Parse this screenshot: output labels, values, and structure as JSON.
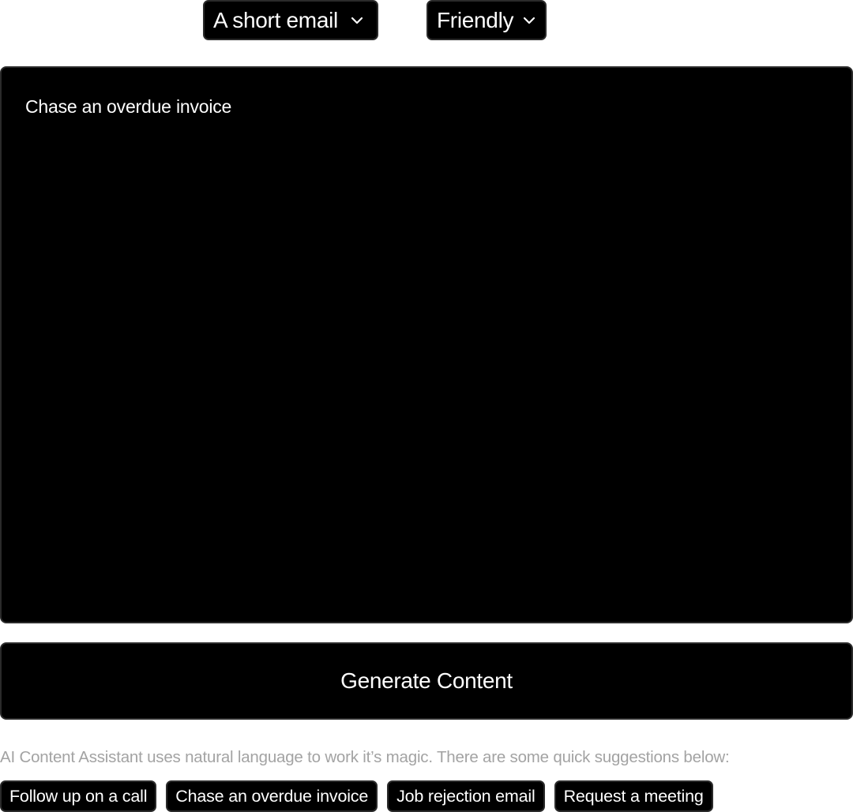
{
  "controls": {
    "length_select": {
      "value": "A short email",
      "icon": "chevron-down-icon"
    },
    "tone_select": {
      "value": "Friendly",
      "icon": "chevron-down-icon"
    }
  },
  "prompt": {
    "value": "Chase an overdue invoice"
  },
  "generate_button": {
    "label": "Generate Content"
  },
  "helper_text": "AI Content Assistant uses natural language to work it’s magic. There are some quick suggestions below:",
  "suggestions": [
    "Follow up on a call",
    "Chase an overdue invoice",
    "Job rejection email",
    "Request a meeting"
  ],
  "colors": {
    "background": "#ffffff",
    "surface": "#000000",
    "border": "#2b2b2b",
    "text": "#ffffff",
    "muted_text": "#a3a3a3"
  }
}
